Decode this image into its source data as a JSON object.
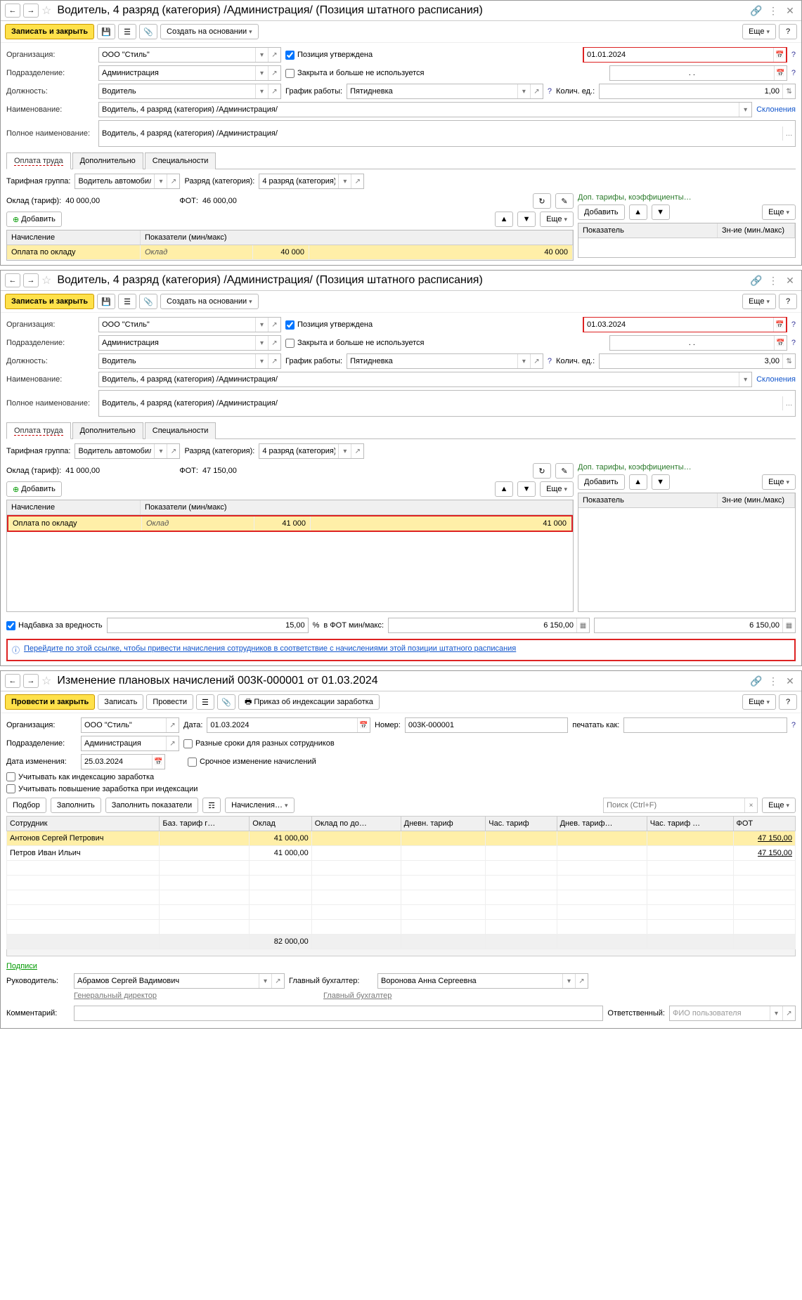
{
  "w1": {
    "title": "Водитель, 4 разряд (категория) /Администрация/ (Позиция штатного расписания)",
    "save_close": "Записать и закрыть",
    "create_based": "Создать на основании",
    "more": "Еще",
    "org_lbl": "Организация:",
    "org": "ООО \"Стиль\"",
    "approved": "Позиция утверждена",
    "date": "01.01.2024",
    "dept_lbl": "Подразделение:",
    "dept": "Администрация",
    "closed": "Закрыта и больше не используется",
    "dotdot": ". .",
    "post_lbl": "Должность:",
    "post": "Водитель",
    "sched_lbl": "График работы:",
    "sched": "Пятидневка",
    "qty_lbl": "Колич. ед.:",
    "qty": "1,00",
    "name_lbl": "Наименование:",
    "name": "Водитель, 4 разряд (категория) /Администрация/",
    "decl": "Склонения",
    "full_lbl": "Полное наименование:",
    "full": "Водитель, 4 разряд (категория) /Администрация/",
    "tab1": "Оплата труда",
    "tab2": "Дополнительно",
    "tab3": "Специальности",
    "tgroup_lbl": "Тарифная группа:",
    "tgroup": "Водитель автомобиля",
    "rank_lbl": "Разряд (категория):",
    "rank": "4 разряд (категория)",
    "oklad_lbl": "Оклад (тариф):",
    "oklad": "40 000,00",
    "fot_lbl": "ФОТ:",
    "fot": "46 000,00",
    "add": "Добавить",
    "ghead1": "Начисление",
    "ghead2": "Показатели (мин/макс)",
    "gr1c1": "Оплата по окладу",
    "gr1c2": "Оклад",
    "gr1c3": "40 000",
    "gr1c4": "40 000",
    "dop_title": "Доп. тарифы, коэффициенты…",
    "rhead1": "Показатель",
    "rhead2": "Зн-ие (мин./макс)"
  },
  "w2": {
    "title": "Водитель, 4 разряд (категория) /Администрация/ (Позиция штатного расписания)",
    "date": "01.03.2024",
    "qty": "3,00",
    "oklad": "41 000,00",
    "fot": "47 150,00",
    "gr1c3": "41 000",
    "gr1c4": "41 000",
    "harm_lbl": "Надбавка за вредность",
    "harm_pct": "15,00",
    "pct": "%",
    "fot_minmax_lbl": "в ФОТ мин/макс:",
    "fot_min": "6 150,00",
    "fot_max": "6 150,00",
    "info": "Перейдите по этой ссылке, чтобы привести начисления сотрудников в соответствие с начислениями этой позиции штатного расписания"
  },
  "w3": {
    "title": "Изменение плановых начислений 003К-000001 от 01.03.2024",
    "run_close": "Провести и закрыть",
    "save": "Записать",
    "run": "Провести",
    "print": "Приказ об индексации заработка",
    "more": "Еще",
    "org_lbl": "Организация:",
    "org": "ООО \"Стиль\"",
    "date_lbl": "Дата:",
    "date": "01.03.2024",
    "num_lbl": "Номер:",
    "num": "003К-000001",
    "printas_lbl": "печатать как:",
    "dept_lbl": "Подразделение:",
    "dept": "Администрация",
    "diff_dates": "Разные сроки для разных сотрудников",
    "urgent": "Срочное изменение начислений",
    "change_date_lbl": "Дата изменения:",
    "change_date": "25.03.2024",
    "idx": "Учитывать как индексацию заработка",
    "idx2": "Учитывать повышение заработка при индексации",
    "sel": "Подбор",
    "fill": "Заполнить",
    "fillind": "Заполнить показатели",
    "nach": "Начисления…",
    "search_ph": "Поиск (Ctrl+F)",
    "th": [
      "Сотрудник",
      "Баз. тариф г…",
      "Оклад",
      "Оклад по до…",
      "Дневн. тариф",
      "Час. тариф",
      "Днев. тариф…",
      "Час. тариф …",
      "ФОТ"
    ],
    "rows": [
      {
        "emp": "Антонов Сергей Петрович",
        "oklad": "41 000,00",
        "fot": "47 150,00"
      },
      {
        "emp": "Петров Иван Ильич",
        "oklad": "41 000,00",
        "fot": "47 150,00"
      }
    ],
    "total_oklad": "82 000,00",
    "signs": "Подписи",
    "ruk_lbl": "Руководитель:",
    "ruk": "Абрамов Сергей Вадимович",
    "ruk_pos": "Генеральный директор",
    "gb_lbl": "Главный бухгалтер:",
    "gb": "Воронова Анна Сергеевна",
    "gb_pos": "Главный бухгалтер",
    "comm_lbl": "Комментарий:",
    "resp_lbl": "Ответственный:",
    "resp": "ФИО пользователя"
  }
}
